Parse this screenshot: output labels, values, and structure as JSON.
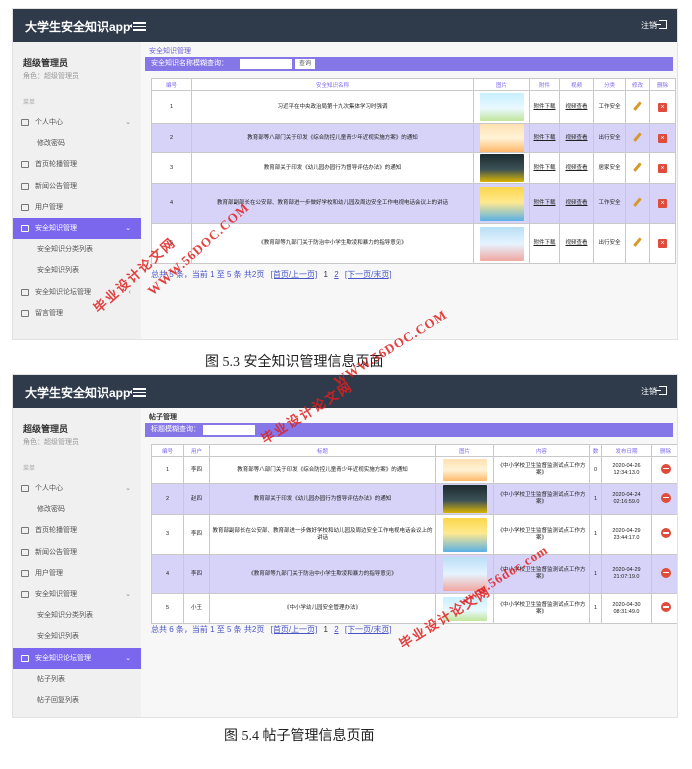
{
  "app": {
    "brand": "大学生安全知识app",
    "logout": "注销"
  },
  "sidebar": {
    "user_name": "超级管理员",
    "user_role": "角色：超级管理员",
    "section": "菜单",
    "items": [
      "个人中心",
      "修改密码",
      "首页轮播管理",
      "新闻公告管理",
      "用户管理",
      "安全知识管理",
      "安全知识分类列表",
      "安全知识列表",
      "安全知识论坛管理",
      "帖子列表",
      "帖子回复列表",
      "留言管理"
    ]
  },
  "screen1": {
    "page_title": "安全知识管理",
    "search_label": "安全知识名称模糊查询：",
    "search_button": "查询",
    "headers": [
      "编号",
      "安全知识名称",
      "图片",
      "附件",
      "视频",
      "分类",
      "修改",
      "删除"
    ],
    "rows": [
      {
        "id": "1",
        "name": "习近平在中央政治局第十九次集体学习时强调",
        "attachment": "附件下载",
        "video": "视频查看",
        "category": "工作安全"
      },
      {
        "id": "2",
        "name": "教育部等八部门关于印发《综合防控儿童青少年近视实施方案》的通知",
        "attachment": "附件下载",
        "video": "视频查看",
        "category": "出行安全"
      },
      {
        "id": "3",
        "name": "教育部关于印发《幼儿园办园行为督导评估办法》的通知",
        "attachment": "附件下载",
        "video": "视频查看",
        "category": "居家安全"
      },
      {
        "id": "4",
        "name": "教育部副部长在公安部、教育部进一步做好学校和幼儿园及周边安全工作电视电话会议上的讲话",
        "attachment": "附件下载",
        "video": "视频查看",
        "category": "工作安全"
      },
      {
        "id": "5",
        "name": "《教育部等九部门关于防治中小学生欺凌和暴力的指导意见》",
        "attachment": "附件下载",
        "video": "视频查看",
        "category": "出行安全"
      }
    ],
    "pager": {
      "summary": "总共 5 条，当前 1 至 5 条 共2页",
      "first_prev": "[首页/上一页]",
      "pages": [
        "1",
        "2"
      ],
      "next_last": "[下一页/末页]"
    }
  },
  "screen2": {
    "page_title": "帖子管理",
    "search_label": "标题模糊查询：",
    "headers": [
      "编号",
      "用户",
      "标题",
      "图片",
      "内容",
      "数",
      "发布日期",
      "删除"
    ],
    "rows": [
      {
        "id": "1",
        "user": "李四",
        "title": "教育部等八部门关于印发《综合防控儿童青少年近视实施方案》的通知",
        "content": "《中小学校卫生监督监测试点工作方案》",
        "count": "0",
        "date": "2020-04-26",
        "time": "12:34:13.0"
      },
      {
        "id": "2",
        "user": "赵四",
        "title": "教育部关于印发《幼儿园办园行为督导评估办法》的通知",
        "content": "《中小学校卫生监督监测试点工作方案》",
        "count": "1",
        "date": "2020-04-24",
        "time": "02:16:59.0"
      },
      {
        "id": "3",
        "user": "李四",
        "title": "教育部副部长在公安部、教育部进一步做好学校和幼儿园及周边安全工作电视电话会议上的讲话",
        "content": "《中小学校卫生监督监测试点工作方案》",
        "count": "1",
        "date": "2020-04-29",
        "time": "23:44:17.0"
      },
      {
        "id": "4",
        "user": "李四",
        "title": "《教育部等九部门关于防治中小学生欺凌和暴力的指导意见》",
        "content": "《中小学校卫生监督监测试点工作方案》",
        "count": "1",
        "date": "2020-04-29",
        "time": "21:07:19.0"
      },
      {
        "id": "5",
        "user": "小王",
        "title": "《中小学幼儿园安全管理办法》",
        "content": "《中小学校卫生监督监测试点工作方案》",
        "count": "1",
        "date": "2020-04-30",
        "time": "08:31:49.0"
      }
    ],
    "pager": {
      "summary": "总共 6 条，当前 1 至 5 条 共2页",
      "first_prev": "[首页/上一页]",
      "pages": [
        "1",
        "2"
      ],
      "next_last": "[下一页/末页]"
    }
  },
  "captions": {
    "fig1": "图 5.3 安全知识管理信息页面",
    "fig2": "图 5.4 帖子管理信息页面"
  },
  "watermarks": {
    "site": "WWW.56DOC.COM",
    "site_lower": "www.56doc.com",
    "slogan": "毕业设计论文网"
  }
}
